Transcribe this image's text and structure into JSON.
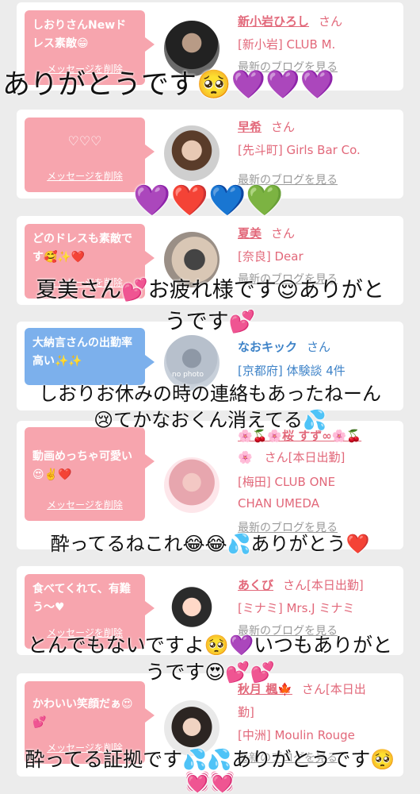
{
  "cards": [
    {
      "message": "しおりさんNewドレス素敵😁",
      "delete_label": "メッセージを削除",
      "name": "新小岩ひろし",
      "honorific": "さん",
      "shop": "[新小岩] CLUB M.",
      "blog": "最新のブログを見る"
    },
    {
      "message": "♡♡♡",
      "delete_label": "メッセージを削除",
      "name": "早希",
      "honorific": "さん",
      "shop": "[先斗町] Girls Bar Co.",
      "blog": "最新のブログを見る"
    },
    {
      "message": "どのドレスも素敵です🥰✨❤️",
      "delete_label": "メッセージを削除",
      "name": "夏美",
      "honorific": "さん",
      "shop": "[奈良] Dear",
      "blog": "最新のブログを見る"
    },
    {
      "message": "大納言さんの出勤率高い✨✨",
      "name": "なおキック",
      "honorific": "さん",
      "shop": "[京都府] 体験談 4件",
      "avatar_text": "no photo"
    },
    {
      "message": "動画めっちゃ可愛い😍✌️❤️",
      "delete_label": "メッセージを削除",
      "name": "🌸🍒🌸桜 すず∞🌸🍒",
      "honorific": "🌸　さん[本日出勤]",
      "shop": "[梅田] CLUB ONE",
      "shop2": "CHAN UMEDA",
      "blog": "最新のブログを見る"
    },
    {
      "message": "食べてくれて、有難う〜♥",
      "delete_label": "メッセージを削除",
      "name": "あくび",
      "honorific": "さん[本日出勤]",
      "shop": "[ミナミ] Mrs.J ミナミ",
      "blog": "最新のブログを見る"
    },
    {
      "message": "かわいい笑顔だぁ😍💕",
      "delete_label": "メッセージを削除",
      "name": "秋月 楓🍁",
      "honorific": "さん[本日出",
      "honorific2": "勤]",
      "shop": "[中洲] Moulin Rouge",
      "blog": "最新のブログを見る"
    }
  ],
  "overlays": {
    "o1": "ありがとうです🥺💜💜💜",
    "o2": "💜❤️💙💚",
    "o3a": "夏美さん💕お疲れ様です😌ありがと",
    "o3b": "うです💕",
    "o4a": "しおりお休みの時の連絡もあったねーん",
    "o4b": "😢てかなおくん消えてる💦",
    "o5": "酔ってるねこれ😂😂💦ありがとう❤️",
    "o6a": "とんでもないですよ🥺💜いつもありがと",
    "o6b": "うです😍💕💕",
    "o7a": "酔ってる証拠です💦💦ありがとうです🥺",
    "o7b": "💓💓"
  },
  "colors": {
    "bubble_pink": "#f7a5ae",
    "bubble_blue": "#7cb0ec",
    "name_pink": "#e2687a",
    "name_blue": "#3e83c8"
  }
}
